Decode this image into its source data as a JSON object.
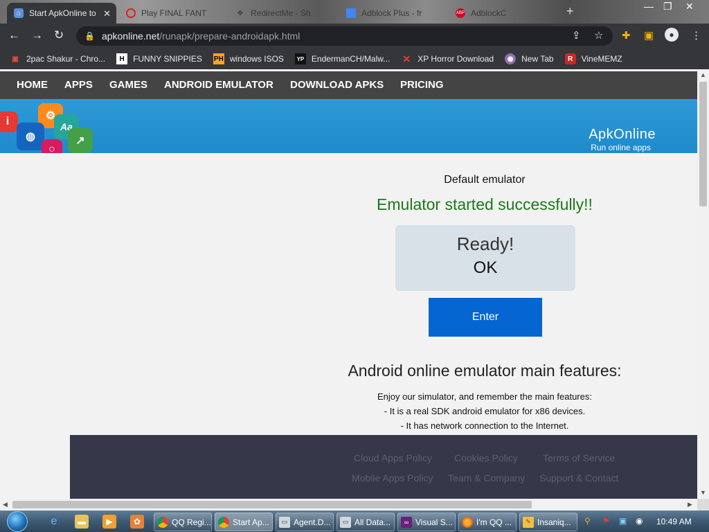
{
  "browser": {
    "tabs": [
      {
        "title": "Start ApkOnline to",
        "active": true,
        "icon": "apkonline-icon"
      },
      {
        "title": "Play FINAL FANT",
        "active": false,
        "icon": "opera-icon"
      },
      {
        "title": "RedirectMe - Sh",
        "active": false,
        "icon": "redirect-icon"
      },
      {
        "title": "Adblock Plus - fr",
        "active": false,
        "icon": "chrome-store-icon"
      },
      {
        "title": "AdblockC",
        "active": false,
        "icon": "abp-icon"
      }
    ],
    "new_tab_label": "+",
    "address": {
      "host": "apkonline.net",
      "path": "/runapk/prepare-androidapk.html"
    },
    "bookmarks": [
      {
        "label": "2pac Shakur - Chro...",
        "icon": "bookmark-2pac-icon",
        "badge": "▣",
        "bg": "#c0392b"
      },
      {
        "label": "FUNNY SNIPPIES",
        "icon": "bookmark-h-icon",
        "badge": "H",
        "bg": "#202124"
      },
      {
        "label": "windows ISOS",
        "icon": "bookmark-ph-icon",
        "badge": "PH",
        "bg": "#f5a623"
      },
      {
        "label": "EndermanCH/Malw...",
        "icon": "bookmark-yp-icon",
        "badge": "YP",
        "bg": "#3a3a3a"
      },
      {
        "label": "XP Horror Download",
        "icon": "bookmark-x-icon",
        "badge": "X",
        "bg": "#35363a"
      },
      {
        "label": "New Tab",
        "icon": "bookmark-globe-icon",
        "badge": "◉",
        "bg": "#8e44ad"
      },
      {
        "label": "VineMEMZ",
        "icon": "bookmark-r-icon",
        "badge": "R",
        "bg": "#c0392b"
      }
    ]
  },
  "site": {
    "nav": [
      "HOME",
      "APPS",
      "GAMES",
      "ANDROID EMULATOR",
      "DOWNLOAD APKS",
      "PRICING"
    ],
    "brand_name": "ApkOnline",
    "brand_tagline": "Run online apps",
    "emulator_name": "Default emulator",
    "status_message": "Emulator started successfully!!",
    "status_box": {
      "line1": "Ready!",
      "line2": "OK"
    },
    "enter_label": "Enter",
    "features_title": "Android online emulator main features:",
    "features_lines": [
      "Enjoy our simulator, and remember the main features:",
      "- It is a real SDK android emulator for x86 devices.",
      "- It has network connection to the Internet."
    ],
    "footer_links": [
      "Cloud Apps Policy",
      "Cookies Policy",
      "Terms of Service",
      "Mobile Apps Policy",
      "Team & Company",
      "Support & Contact"
    ],
    "colors": {
      "success": "#1a7a17",
      "enter_button": "#0565d1",
      "nav_bg": "#444444",
      "footer_bg": "#37374a"
    }
  },
  "taskbar": {
    "tasks": [
      {
        "label": "QQ Regi...",
        "icon": "chrome-icon"
      },
      {
        "label": "Start Ap...",
        "icon": "chrome-icon"
      },
      {
        "label": "Agent.D...",
        "icon": "window-icon"
      },
      {
        "label": "All Data...",
        "icon": "window-icon"
      },
      {
        "label": "Visual S...",
        "icon": "visual-studio-icon"
      },
      {
        "label": "I'm QQ ...",
        "icon": "firefox-icon"
      },
      {
        "label": "Insaniq...",
        "icon": "paint-icon"
      }
    ],
    "clock": "10:49 AM"
  }
}
